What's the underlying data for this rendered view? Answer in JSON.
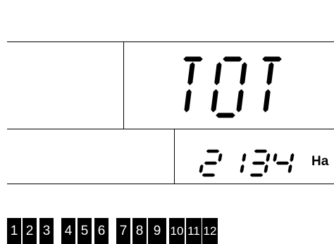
{
  "display": {
    "main_text": "TOT",
    "value_text": "2134",
    "unit_text": "Ha"
  },
  "channels": [
    "1",
    "2",
    "3",
    "4",
    "5",
    "6",
    "7",
    "8",
    "9",
    "10",
    "11",
    "12"
  ],
  "colors": {
    "background": "#ffffff",
    "segment": "#000000",
    "channel_box": "#000000",
    "channel_text": "#ffffff"
  }
}
